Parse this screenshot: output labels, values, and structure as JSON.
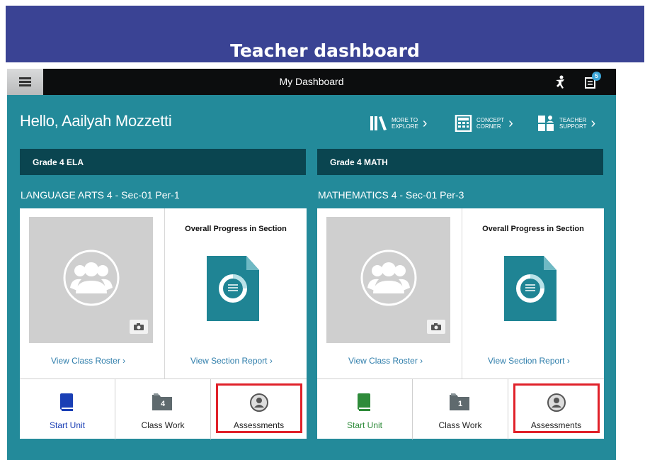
{
  "banner": {
    "title": "Teacher dashboard"
  },
  "topbar": {
    "title": "My Dashboard",
    "notification_count": "5"
  },
  "greeting": "Hello, Aailyah Mozzetti",
  "quicklinks": [
    {
      "line1": "MORE TO",
      "line2": "EXPLORE",
      "icon": "books-icon"
    },
    {
      "line1": "CONCEPT",
      "line2": "CORNER",
      "icon": "calculator-icon"
    },
    {
      "line1": "TEACHER",
      "line2": "SUPPORT",
      "icon": "teacher-support-icon"
    }
  ],
  "classes": [
    {
      "grade": "Grade 4 ELA",
      "section": "LANGUAGE ARTS 4 - Sec-01 Per-1",
      "progress_title": "Overall Progress in Section",
      "roster_link": "View Class Roster",
      "report_link": "View Section Report",
      "actions": [
        {
          "label": "Start Unit",
          "color": "#1a3fb5"
        },
        {
          "label": "Class Work",
          "count": "4"
        },
        {
          "label": "Assessments"
        }
      ]
    },
    {
      "grade": "Grade 4 MATH",
      "section": "MATHEMATICS 4 - Sec-01 Per-3",
      "progress_title": "Overall Progress in Section",
      "roster_link": "View Class Roster",
      "report_link": "View Section Report",
      "actions": [
        {
          "label": "Start Unit",
          "color": "#2e8b3a"
        },
        {
          "label": "Class Work",
          "count": "1"
        },
        {
          "label": "Assessments"
        }
      ]
    }
  ],
  "colors": {
    "banner": "#3a4394",
    "app_bg": "#238a9a",
    "grade_bar": "#0a4550",
    "link": "#2f7eab",
    "highlight": "#e0212a"
  }
}
